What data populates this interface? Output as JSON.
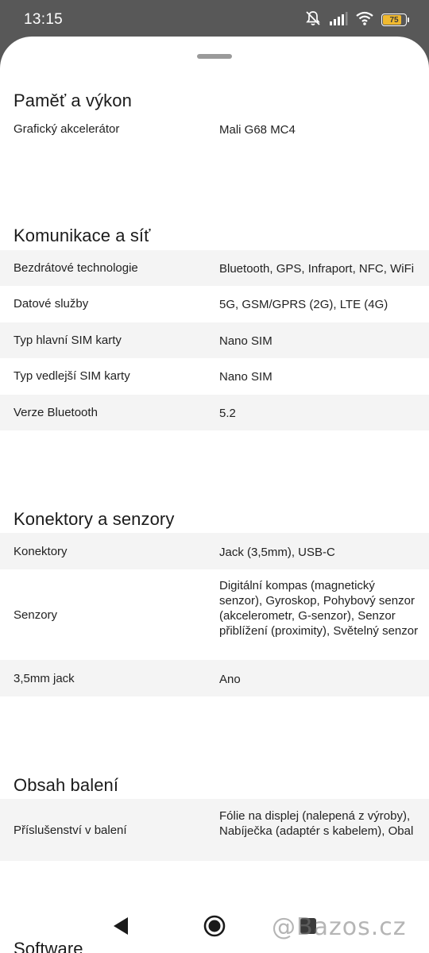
{
  "status_bar": {
    "time": "13:15",
    "battery_level": "75",
    "battery_color": "#f0b92f"
  },
  "sections": [
    {
      "title": "Paměť a výkon",
      "rows": [
        {
          "label": "Grafický akcelerátor",
          "value": "Mali G68 MC4"
        }
      ]
    },
    {
      "title": "Komunikace a síť",
      "rows": [
        {
          "label": "Bezdrátové technologie",
          "value": "Bluetooth, GPS, Infraport, NFC, WiFi"
        },
        {
          "label": "Datové služby",
          "value": "5G, GSM/GPRS (2G), LTE (4G)"
        },
        {
          "label": "Typ hlavní SIM karty",
          "value": "Nano SIM"
        },
        {
          "label": "Typ vedlejší SIM karty",
          "value": "Nano SIM"
        },
        {
          "label": "Verze Bluetooth",
          "value": "5.2"
        }
      ]
    },
    {
      "title": "Konektory a senzory",
      "rows": [
        {
          "label": "Konektory",
          "value": "Jack (3,5mm), USB-C"
        },
        {
          "label": "Senzory",
          "value": "Digitální kompas (magnetický senzor), Gyroskop, Pohybový senzor (akcelerometr, G-senzor), Senzor přiblížení (proximity), Světelný senzor"
        },
        {
          "label": "3,5mm jack",
          "value": "Ano"
        }
      ]
    },
    {
      "title": "Obsah balení",
      "rows": [
        {
          "label": "Příslušenství v balení",
          "value": "Fólie na displej (nalepená z výroby), Nabíječka (adaptér s kabelem), Obal"
        }
      ]
    },
    {
      "title": "Software",
      "rows": []
    }
  ],
  "watermark": "@Bazos.cz",
  "nav": {
    "back_icon": "back-triangle-icon",
    "home_icon": "home-circle-icon",
    "recents_icon": "recents-square-icon"
  }
}
